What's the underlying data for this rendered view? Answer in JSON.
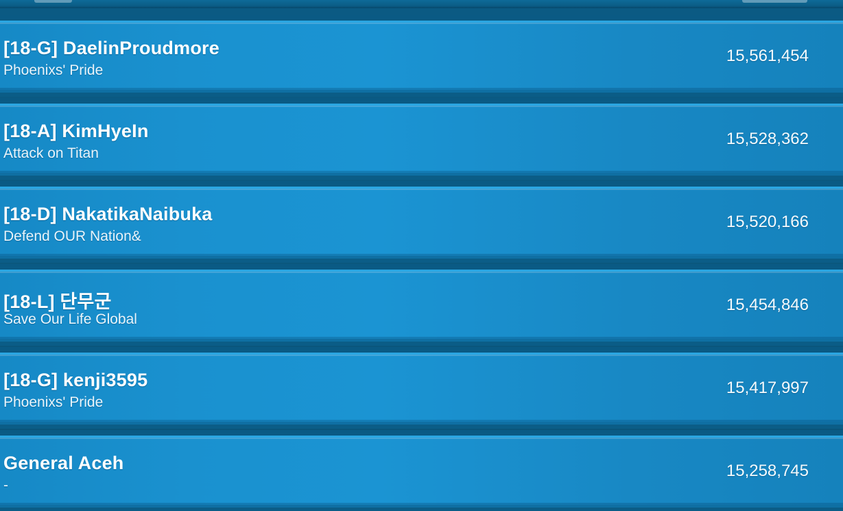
{
  "leaderboard": {
    "rows": [
      {
        "tag": "[18-G]",
        "name": "[18-G] DaelinProudmore",
        "alliance": "Phoenixs' Pride",
        "score": "15,561,454"
      },
      {
        "tag": "[18-A]",
        "name": "[18-A] KimHyeIn",
        "alliance": "Attack on Titan",
        "score": "15,528,362"
      },
      {
        "tag": "[18-D]",
        "name": "[18-D] NakatikaNaibuka",
        "alliance": "Defend OUR Nation&",
        "score": "15,520,166"
      },
      {
        "tag": "[18-L]",
        "name": "[18-L] 단무군",
        "alliance": "Save Our Life Global",
        "score": "15,454,846"
      },
      {
        "tag": "[18-G]",
        "name": "[18-G] kenji3595",
        "alliance": "Phoenixs' Pride",
        "score": "15,417,997"
      },
      {
        "tag": "",
        "name": "General Aceh",
        "alliance": "-",
        "score": "15,258,745"
      }
    ]
  }
}
